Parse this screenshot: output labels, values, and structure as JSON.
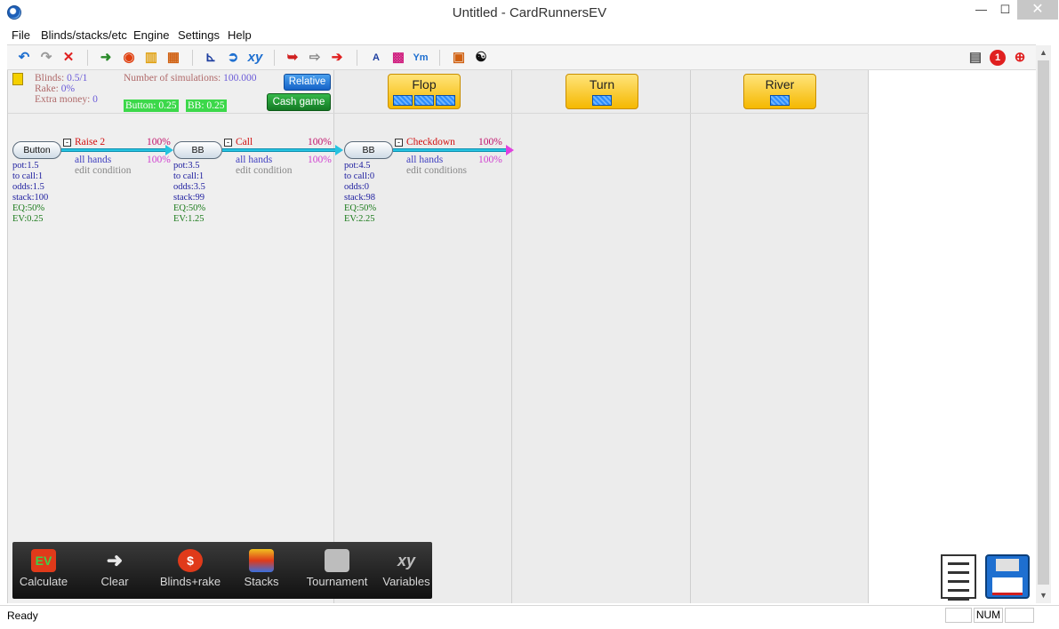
{
  "window": {
    "title": "Untitled - CardRunnersEV",
    "min": "—",
    "max": "☐",
    "close": "✕"
  },
  "menu": [
    "File",
    "Blinds/stacks/etc",
    "Engine",
    "Settings",
    "Help"
  ],
  "toolbar_icons": [
    "undo-icon",
    "redo-icon",
    "delete-icon",
    "ev-calc-icon",
    "blinds-icon",
    "stacks-icon",
    "tournament-icon",
    "chart-icon",
    "go-icon",
    "xy-icon",
    "pointer-icon",
    "arrow-white-icon",
    "arrow-red-icon",
    "font-icon",
    "grid-icon",
    "ym-icon",
    "export-icon",
    "yin-yang-icon",
    "page-icon",
    "alert-icon",
    "add-icon"
  ],
  "info": {
    "blinds_label": "Blinds:",
    "blinds_value": "0.5/1",
    "rake_label": "Rake:",
    "rake_value": "0%",
    "extra_label": "Extra money:",
    "extra_value": "0",
    "sims_label": "Number of simulations:",
    "sims_value": "100.000",
    "button_tag": "Button: 0.25",
    "bb_tag": "BB: 0.25",
    "relative_btn": "Relative",
    "cash_btn": "Cash game"
  },
  "streets": {
    "flop": "Flop",
    "turn": "Turn",
    "river": "River"
  },
  "tree": {
    "nodes": [
      {
        "name": "Button",
        "action": "Raise 2",
        "pct": "100%",
        "range": "all hands",
        "range_pct": "100%",
        "condition": "edit condition",
        "stats": [
          "pot:1.5",
          "to call:1",
          "odds:1.5",
          "stack:100"
        ],
        "eq": "EQ:50%",
        "ev": "EV:0.25"
      },
      {
        "name": "BB",
        "action": "Call",
        "pct": "100%",
        "range": "all hands",
        "range_pct": "100%",
        "condition": "edit condition",
        "stats": [
          "pot:3.5",
          "to call:1",
          "odds:3.5",
          "stack:99"
        ],
        "eq": "EQ:50%",
        "ev": "EV:1.25"
      },
      {
        "name": "BB",
        "action": "Checkdown",
        "pct": "100%",
        "range": "all hands",
        "range_pct": "100%",
        "condition": "edit conditions",
        "stats": [
          "pot:4.5",
          "to call:0",
          "odds:0",
          "stack:98"
        ],
        "eq": "EQ:50%",
        "ev": "EV:2.25"
      }
    ]
  },
  "dock": [
    {
      "label": "Calculate",
      "icon": "ev-calc-icon"
    },
    {
      "label": "Clear",
      "icon": "arrow-right-icon"
    },
    {
      "label": "Blinds+rake",
      "icon": "chip-icon"
    },
    {
      "label": "Stacks",
      "icon": "chip-stack-icon"
    },
    {
      "label": "Tournament",
      "icon": "tournament-icon"
    },
    {
      "label": "Variables",
      "icon": "xy-icon"
    }
  ],
  "status": {
    "text": "Ready",
    "num": "NUM"
  }
}
